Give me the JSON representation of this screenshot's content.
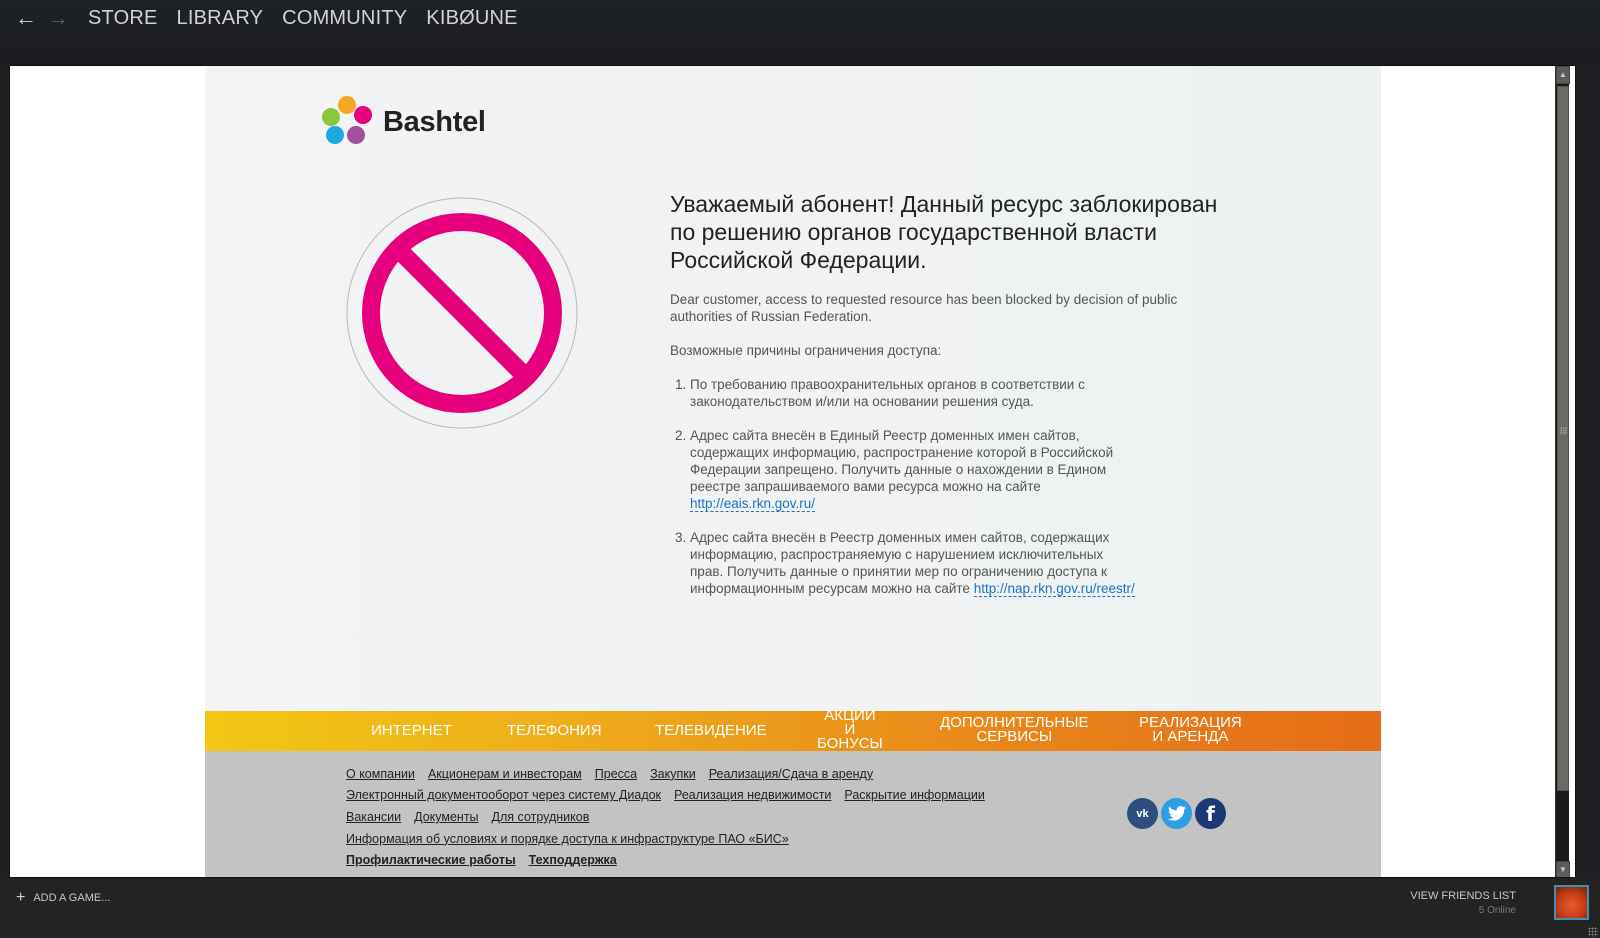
{
  "steam": {
    "nav": {
      "back_icon": "arrow-left",
      "forward_icon": "arrow-right",
      "tabs": [
        "STORE",
        "LIBRARY",
        "COMMUNITY",
        "KIBØUNE"
      ]
    },
    "bottom": {
      "add_game": "ADD A GAME...",
      "view_friends": "VIEW FRIENDS LIST",
      "online": "5 Online"
    }
  },
  "page": {
    "brand": "Bashtel",
    "logo_colors": [
      "#f5a623",
      "#e6007e",
      "#8cc63f",
      "#1ea7e1",
      "#a3509a"
    ],
    "sign_color": "#e6007e",
    "headline": "Уважаемый абонент! Данный ресурс заблокирован по решению органов государственной власти Российской Федерации.",
    "english_notice": "Dear customer, access to requested resource has been blocked by decision of public authorities of Russian Federation.",
    "reasons_title": "Возможные причины ограничения доступа:",
    "reasons": [
      {
        "text": "По требованию правоохранительных органов в соответствии с законодательством и/или на основании решения суда.",
        "link": ""
      },
      {
        "text": "Адрес сайта внесён в Единый Реестр доменных имен сайтов, содержащих информацию, распространение которой в Российской Федерации запрещено. Получить данные о нахождении в Едином реестре запрашиваемого вами ресурса можно на сайте ",
        "link": "http://eais.rkn.gov.ru/"
      },
      {
        "text": "Адрес сайта внесён в Реестр доменных имен сайтов, содержащих информацию, распространяемую с нарушением исключительных прав. Получить данные о принятии мер по ограничению доступа к информационным ресурсам можно на сайте ",
        "link": "http://nap.rkn.gov.ru/reestr/"
      }
    ],
    "menu": [
      "ИНТЕРНЕТ",
      "ТЕЛЕФОНИЯ",
      "ТЕЛЕВИДЕНИЕ",
      "АКЦИИ\nИ\nБОНУСЫ",
      "ДОПОЛНИТЕЛЬНЫЕ\nСЕРВИСЫ",
      "РЕАЛИЗАЦИЯ\nИ АРЕНДА"
    ],
    "footer_rows": [
      [
        "О компании",
        "Акционерам и инвесторам",
        "Пресса",
        "Закупки",
        "Реализация/Сдача в аренду"
      ],
      [
        "Электронный документооборот через систему Диадок",
        "Реализация недвижимости",
        "Раскрытие информации"
      ],
      [
        "Вакансии",
        "Документы",
        "Для сотрудников"
      ],
      [
        "Информация об условиях и порядке доступа к инфраструктуре ПАО «БИС»"
      ],
      [
        "Профилактические работы",
        "Техподдержка"
      ]
    ],
    "social": [
      {
        "name": "vk",
        "glyph": "vk",
        "color": "#2c4f7d"
      },
      {
        "name": "twitter",
        "glyph": "t",
        "color": "#2f9ee3"
      },
      {
        "name": "facebook",
        "glyph": "f",
        "color": "#1b3a75"
      }
    ]
  }
}
